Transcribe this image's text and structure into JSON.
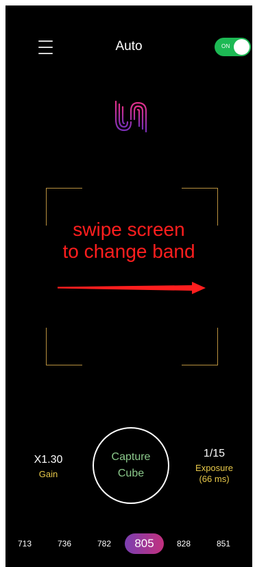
{
  "header": {
    "title": "Auto",
    "toggle_label": "ON",
    "toggle_on": true,
    "menu_icon": "hamburger-menu-icon"
  },
  "logo": {
    "icon": "app-logo-icon"
  },
  "hint": {
    "line1": "swipe screen",
    "line2": "to change band",
    "color": "#ff1e1e"
  },
  "gain": {
    "value": "X1.30",
    "label": "Gain"
  },
  "capture": {
    "line1": "Capture",
    "line2": "Cube"
  },
  "exposure": {
    "value": "1/15",
    "label_line1": "Exposure",
    "label_line2": "(66 ms)"
  },
  "bands": {
    "items": [
      "713",
      "736",
      "782",
      "805",
      "828",
      "851"
    ],
    "selected": "805"
  },
  "colors": {
    "accent_label": "#e8c94a",
    "toggle": "#1db954",
    "capture_text": "#8bc98b",
    "viewfinder": "#b9913f"
  }
}
